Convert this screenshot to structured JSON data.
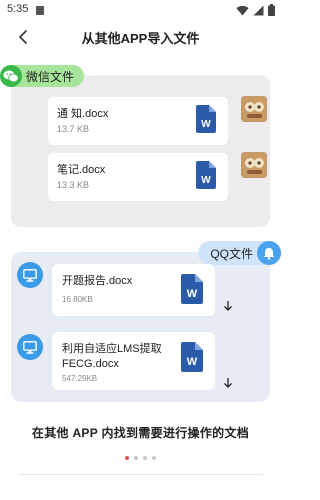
{
  "status_bar": {
    "time": "5:35"
  },
  "header": {
    "title": "从其他APP导入文件"
  },
  "wechat": {
    "tag_label": "微信文件",
    "files": [
      {
        "name": "通  知.docx",
        "size": "13.7 KB"
      },
      {
        "name": "笔记.docx",
        "size": "13.3 KB"
      }
    ]
  },
  "qq": {
    "tag_label": "QQ文件",
    "files": [
      {
        "name": "开题报告.docx",
        "size": "16.80KB"
      },
      {
        "name": "利用自适应LMS提取FECG.docx",
        "size": "547.29KB"
      }
    ]
  },
  "caption": "在其他 APP 内找到需要进行操作的文档",
  "pager": {
    "total": 4,
    "active": 1
  },
  "colors": {
    "wechat_green": "#3bb84a",
    "wechat_tag": "#a7e69a",
    "qq_blue": "#4aa3ef",
    "qq_tag": "#cfe4fb",
    "word_blue": "#2b5ba8",
    "active_dot": "#e2504c"
  },
  "icons": {
    "back": "chevron-left-icon",
    "wechat": "wechat-icon",
    "word": "word-doc-icon",
    "qq_bell": "bell-icon",
    "pc": "monitor-icon",
    "download": "download-arrow-icon",
    "wifi": "wifi-icon",
    "signal": "signal-icon",
    "battery": "battery-icon"
  }
}
